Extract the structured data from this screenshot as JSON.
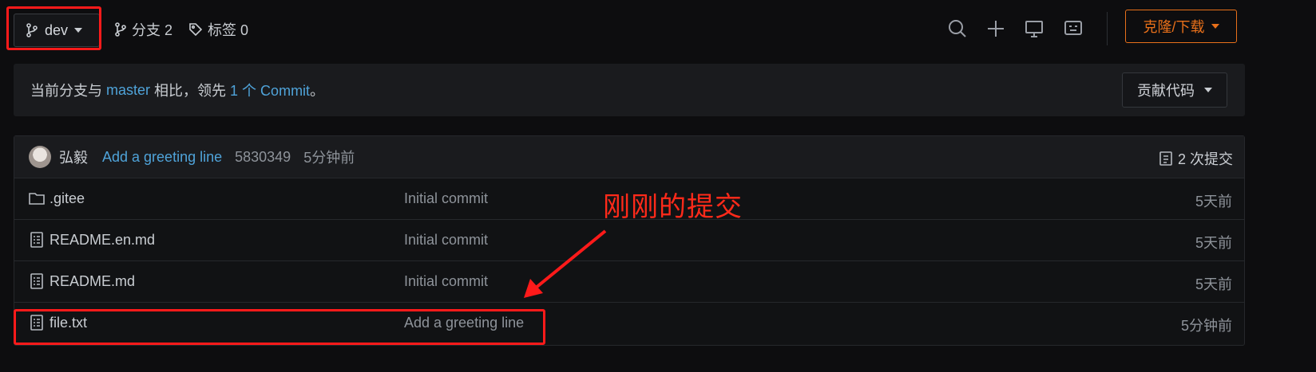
{
  "toolbar": {
    "branch_name": "dev",
    "branches_label": "分支 2",
    "tags_label": "标签 0",
    "clone_label": "克隆/下载",
    "icons": [
      "search-icon",
      "plus-icon",
      "monitor-icon",
      "webide-icon"
    ]
  },
  "compare": {
    "text_prefix": "当前分支与 ",
    "base_branch": "master",
    "text_mid": " 相比，领先 ",
    "ahead_link": "1 个 Commit",
    "text_suffix": "。",
    "contribute_label": "贡献代码"
  },
  "latest_commit": {
    "author": "弘毅",
    "message": "Add a greeting line",
    "hash": "5830349",
    "time": "5分钟前",
    "commits_count": "2 次提交"
  },
  "files": [
    {
      "name": ".gitee",
      "type": "folder",
      "message": "Initial commit",
      "time": "5天前"
    },
    {
      "name": "README.en.md",
      "type": "file",
      "message": "Initial commit",
      "time": "5天前"
    },
    {
      "name": "README.md",
      "type": "file",
      "message": "Initial commit",
      "time": "5天前"
    },
    {
      "name": "file.txt",
      "type": "file",
      "message": "Add a greeting line",
      "time": "5分钟前"
    }
  ],
  "annotation": {
    "text": "刚刚的提交",
    "color": "#ff2a1a"
  },
  "colors": {
    "accent_orange": "#e8701a",
    "link_blue": "#4fa3d9",
    "highlight_red": "#ff1a1a",
    "background": "#0d0d0f"
  }
}
